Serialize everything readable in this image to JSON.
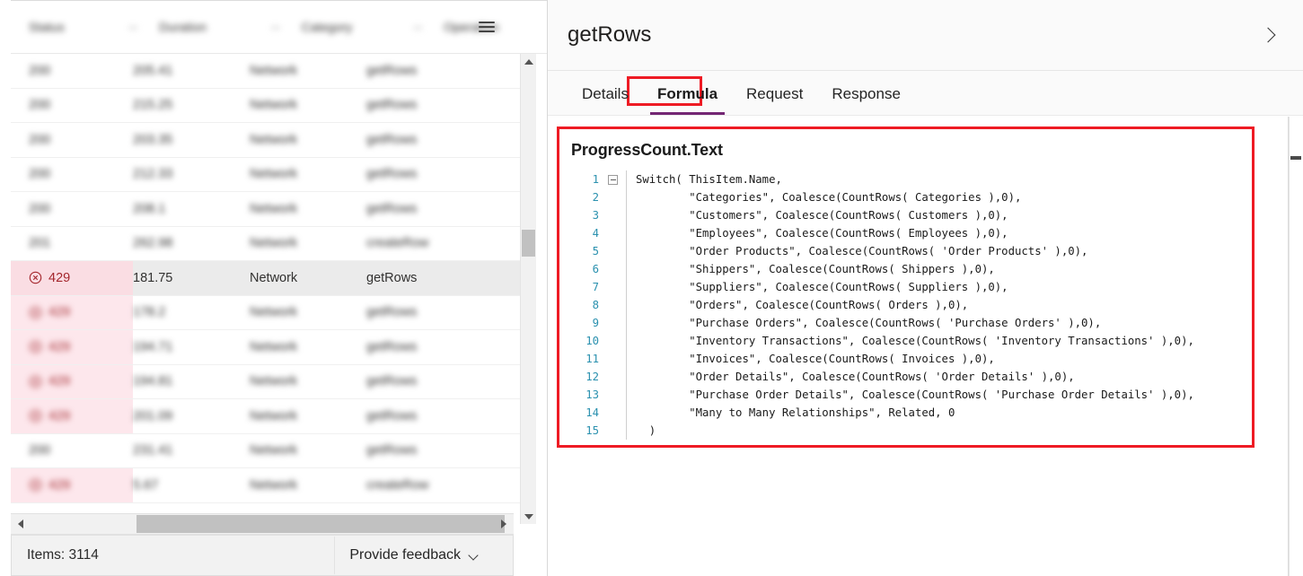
{
  "grid": {
    "columns": [
      {
        "key": "status",
        "label": "Status",
        "filter_icon": "filter-icon"
      },
      {
        "key": "duration",
        "label": "Duration",
        "filter_icon": "filter-icon"
      },
      {
        "key": "category",
        "label": "Category",
        "filter_icon": "filter-icon"
      },
      {
        "key": "operation",
        "label": "Operation",
        "filter_icon": ""
      }
    ],
    "menu_icon": "hamburger-menu-icon",
    "rows": [
      {
        "status": "200",
        "duration": "205.41",
        "category": "Network",
        "operation": "getRows",
        "error": false,
        "blurred": true,
        "selected": false
      },
      {
        "status": "200",
        "duration": "215.25",
        "category": "Network",
        "operation": "getRows",
        "error": false,
        "blurred": true,
        "selected": false
      },
      {
        "status": "200",
        "duration": "203.35",
        "category": "Network",
        "operation": "getRows",
        "error": false,
        "blurred": true,
        "selected": false
      },
      {
        "status": "200",
        "duration": "212.33",
        "category": "Network",
        "operation": "getRows",
        "error": false,
        "blurred": true,
        "selected": false
      },
      {
        "status": "200",
        "duration": "208.1",
        "category": "Network",
        "operation": "getRows",
        "error": false,
        "blurred": true,
        "selected": false
      },
      {
        "status": "201",
        "duration": "262.98",
        "category": "Network",
        "operation": "createRow",
        "error": false,
        "blurred": true,
        "selected": false
      },
      {
        "status": "429",
        "duration": "181.75",
        "category": "Network",
        "operation": "getRows",
        "error": true,
        "blurred": false,
        "selected": true
      },
      {
        "status": "429",
        "duration": "178.2",
        "category": "Network",
        "operation": "getRows",
        "error": true,
        "blurred": true,
        "selected": false
      },
      {
        "status": "429",
        "duration": "194.71",
        "category": "Network",
        "operation": "getRows",
        "error": true,
        "blurred": true,
        "selected": false
      },
      {
        "status": "429",
        "duration": "194.81",
        "category": "Network",
        "operation": "getRows",
        "error": true,
        "blurred": true,
        "selected": false
      },
      {
        "status": "429",
        "duration": "201.09",
        "category": "Network",
        "operation": "getRows",
        "error": true,
        "blurred": true,
        "selected": false
      },
      {
        "status": "200",
        "duration": "231.41",
        "category": "Network",
        "operation": "getRows",
        "error": false,
        "blurred": true,
        "selected": false
      },
      {
        "status": "429",
        "duration": "5.67",
        "category": "Network",
        "operation": "createRow",
        "error": true,
        "blurred": true,
        "selected": false
      }
    ],
    "error_icon": "error-circle-x-icon",
    "scrollbars": {
      "vertical_up_icon": "scroll-up-arrow-icon",
      "vertical_down_icon": "scroll-down-arrow-icon",
      "horizontal_left_icon": "scroll-left-arrow-icon",
      "horizontal_right_icon": "scroll-right-arrow-icon"
    }
  },
  "status_bar": {
    "items_label": "Items: 3114",
    "feedback_label": "Provide feedback",
    "feedback_chevron_icon": "chevron-down-icon"
  },
  "details_pane": {
    "title": "getRows",
    "collapse_icon": "chevron-right-icon",
    "tabs": [
      {
        "label": "Details",
        "active": false
      },
      {
        "label": "Formula",
        "active": true
      },
      {
        "label": "Request",
        "active": false
      },
      {
        "label": "Response",
        "active": false
      }
    ],
    "active_tab": "Formula",
    "highlight_color": "#ee1b24",
    "tab_underline_color": "#742774"
  },
  "formula": {
    "title": "ProgressCount.Text",
    "fold_icon": "collapse-minus-icon",
    "line_numbers": [
      "1",
      "2",
      "3",
      "4",
      "5",
      "6",
      "7",
      "8",
      "9",
      "10",
      "11",
      "12",
      "13",
      "14",
      "15"
    ],
    "lines": [
      "Switch( ThisItem.Name,",
      "        \"Categories\", Coalesce(CountRows( Categories ),0),",
      "        \"Customers\", Coalesce(CountRows( Customers ),0),",
      "        \"Employees\", Coalesce(CountRows( Employees ),0),",
      "        \"Order Products\", Coalesce(CountRows( 'Order Products' ),0),",
      "        \"Shippers\", Coalesce(CountRows( Shippers ),0),",
      "        \"Suppliers\", Coalesce(CountRows( Suppliers ),0),",
      "        \"Orders\", Coalesce(CountRows( Orders ),0),",
      "        \"Purchase Orders\", Coalesce(CountRows( 'Purchase Orders' ),0),",
      "        \"Inventory Transactions\", Coalesce(CountRows( 'Inventory Transactions' ),0),",
      "        \"Invoices\", Coalesce(CountRows( Invoices ),0),",
      "        \"Order Details\", Coalesce(CountRows( 'Order Details' ),0),",
      "        \"Purchase Order Details\", Coalesce(CountRows( 'Purchase Order Details' ),0),",
      "        \"Many to Many Relationships\", Related, 0",
      "  )"
    ]
  }
}
